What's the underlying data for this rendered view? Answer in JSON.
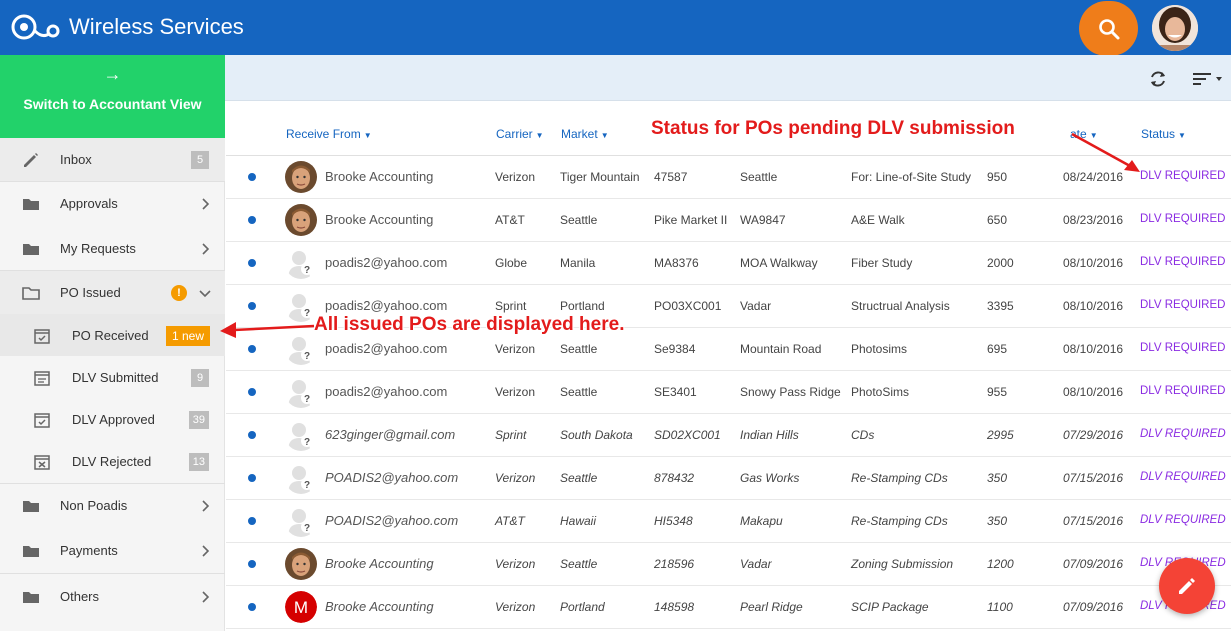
{
  "app": {
    "title": "Wireless Services"
  },
  "colors": {
    "brand": "#1565c0",
    "accent_green": "#22d26a",
    "orange": "#ef7d1a",
    "status": "#8a2be2",
    "fab": "#f44336",
    "annotation": "#e31b1b"
  },
  "sidebar": {
    "switch_label": "Switch to Accountant View",
    "switch_arrow": "→",
    "items": [
      {
        "label": "Inbox",
        "icon": "pencil-icon",
        "badge": "5"
      },
      {
        "label": "Approvals",
        "icon": "folder-icon"
      },
      {
        "label": "My Requests",
        "icon": "folder-icon"
      },
      {
        "label": "PO Issued",
        "icon": "folder-open-icon",
        "alert": "!"
      },
      {
        "label": "PO Received",
        "icon": "calendar-check-icon",
        "badge": "1 new"
      },
      {
        "label": "DLV Submitted",
        "icon": "calendar-list-icon",
        "badge": "9"
      },
      {
        "label": "DLV Approved",
        "icon": "calendar-check-icon",
        "badge": "39"
      },
      {
        "label": "DLV Rejected",
        "icon": "calendar-x-icon",
        "badge": "13"
      },
      {
        "label": "Non Poadis",
        "icon": "folder-icon"
      },
      {
        "label": "Payments",
        "icon": "folder-icon"
      },
      {
        "label": "Others",
        "icon": "folder-icon"
      }
    ]
  },
  "table": {
    "headers": {
      "receive_from": "Receive From",
      "carrier": "Carrier",
      "market": "Market",
      "date_fragment": "ate",
      "status": "Status"
    },
    "rows": [
      {
        "avatar": "man-photo",
        "from": "Brooke Accounting",
        "carrier": "Verizon",
        "market": "Tiger Mountain",
        "po": "47587",
        "site": "Seattle",
        "desc": "For: Line-of-Site Study",
        "amount": "950",
        "date": "08/24/2016",
        "status": "DLV REQUIRED"
      },
      {
        "avatar": "man-photo",
        "from": "Brooke Accounting",
        "carrier": "AT&T",
        "market": "Seattle",
        "po": "Pike Market II",
        "site": "WA9847",
        "desc": "A&E Walk",
        "amount": "650",
        "date": "08/23/2016",
        "status": "DLV REQUIRED"
      },
      {
        "avatar": "unknown",
        "from": "poadis2@yahoo.com",
        "carrier": "Globe",
        "market": "Manila",
        "po": "MA8376",
        "site": "MOA Walkway",
        "desc": "Fiber Study",
        "amount": "2000",
        "date": "08/10/2016",
        "status": "DLV REQUIRED"
      },
      {
        "avatar": "unknown",
        "from": "poadis2@yahoo.com",
        "carrier": "Sprint",
        "market": "Portland",
        "po": "PO03XC001",
        "site": "Vadar",
        "desc": "Structrual Analysis",
        "amount": "3395",
        "date": "08/10/2016",
        "status": "DLV REQUIRED"
      },
      {
        "avatar": "unknown",
        "from": "poadis2@yahoo.com",
        "carrier": "Verizon",
        "market": "Seattle",
        "po": "Se9384",
        "site": "Mountain Road",
        "desc": "Photosims",
        "amount": "695",
        "date": "08/10/2016",
        "status": "DLV REQUIRED"
      },
      {
        "avatar": "unknown",
        "from": "poadis2@yahoo.com",
        "carrier": "Verizon",
        "market": "Seattle",
        "po": "SE3401",
        "site": "Snowy Pass Ridge",
        "desc": "PhotoSims",
        "amount": "955",
        "date": "08/10/2016",
        "status": "DLV REQUIRED"
      },
      {
        "avatar": "unknown",
        "from": "623ginger@gmail.com",
        "carrier": "Sprint",
        "market": "South Dakota",
        "po": "SD02XC001",
        "site": "Indian Hills",
        "desc": "CDs",
        "amount": "2995",
        "date": "07/29/2016",
        "status": "DLV REQUIRED"
      },
      {
        "avatar": "unknown",
        "from": "POADIS2@yahoo.com",
        "carrier": "Verizon",
        "market": "Seattle",
        "po": "878432",
        "site": "Gas Works",
        "desc": "Re-Stamping CDs",
        "amount": "350",
        "date": "07/15/2016",
        "status": "DLV REQUIRED"
      },
      {
        "avatar": "unknown",
        "from": "POADIS2@yahoo.com",
        "carrier": "AT&T",
        "market": "Hawaii",
        "po": "HI5348",
        "site": "Makapu",
        "desc": "Re-Stamping CDs",
        "amount": "350",
        "date": "07/15/2016",
        "status": "DLV REQUIRED"
      },
      {
        "avatar": "man-photo",
        "from": "Brooke Accounting",
        "carrier": "Verizon",
        "market": "Seattle",
        "po": "218596",
        "site": "Vadar",
        "desc": "Zoning Submission",
        "amount": "1200",
        "date": "07/09/2016",
        "status": "DLV REQUIRED"
      },
      {
        "avatar": "M",
        "from": "Brooke Accounting",
        "carrier": "Verizon",
        "market": "Portland",
        "po": "148598",
        "site": "Pearl Ridge",
        "desc": "SCIP Package",
        "amount": "1100",
        "date": "07/09/2016",
        "status": "DLV REQUIRED"
      }
    ]
  },
  "annotations": {
    "status_note": "Status for POs pending DLV submission",
    "issued_note": "All issued POs are displayed here."
  }
}
